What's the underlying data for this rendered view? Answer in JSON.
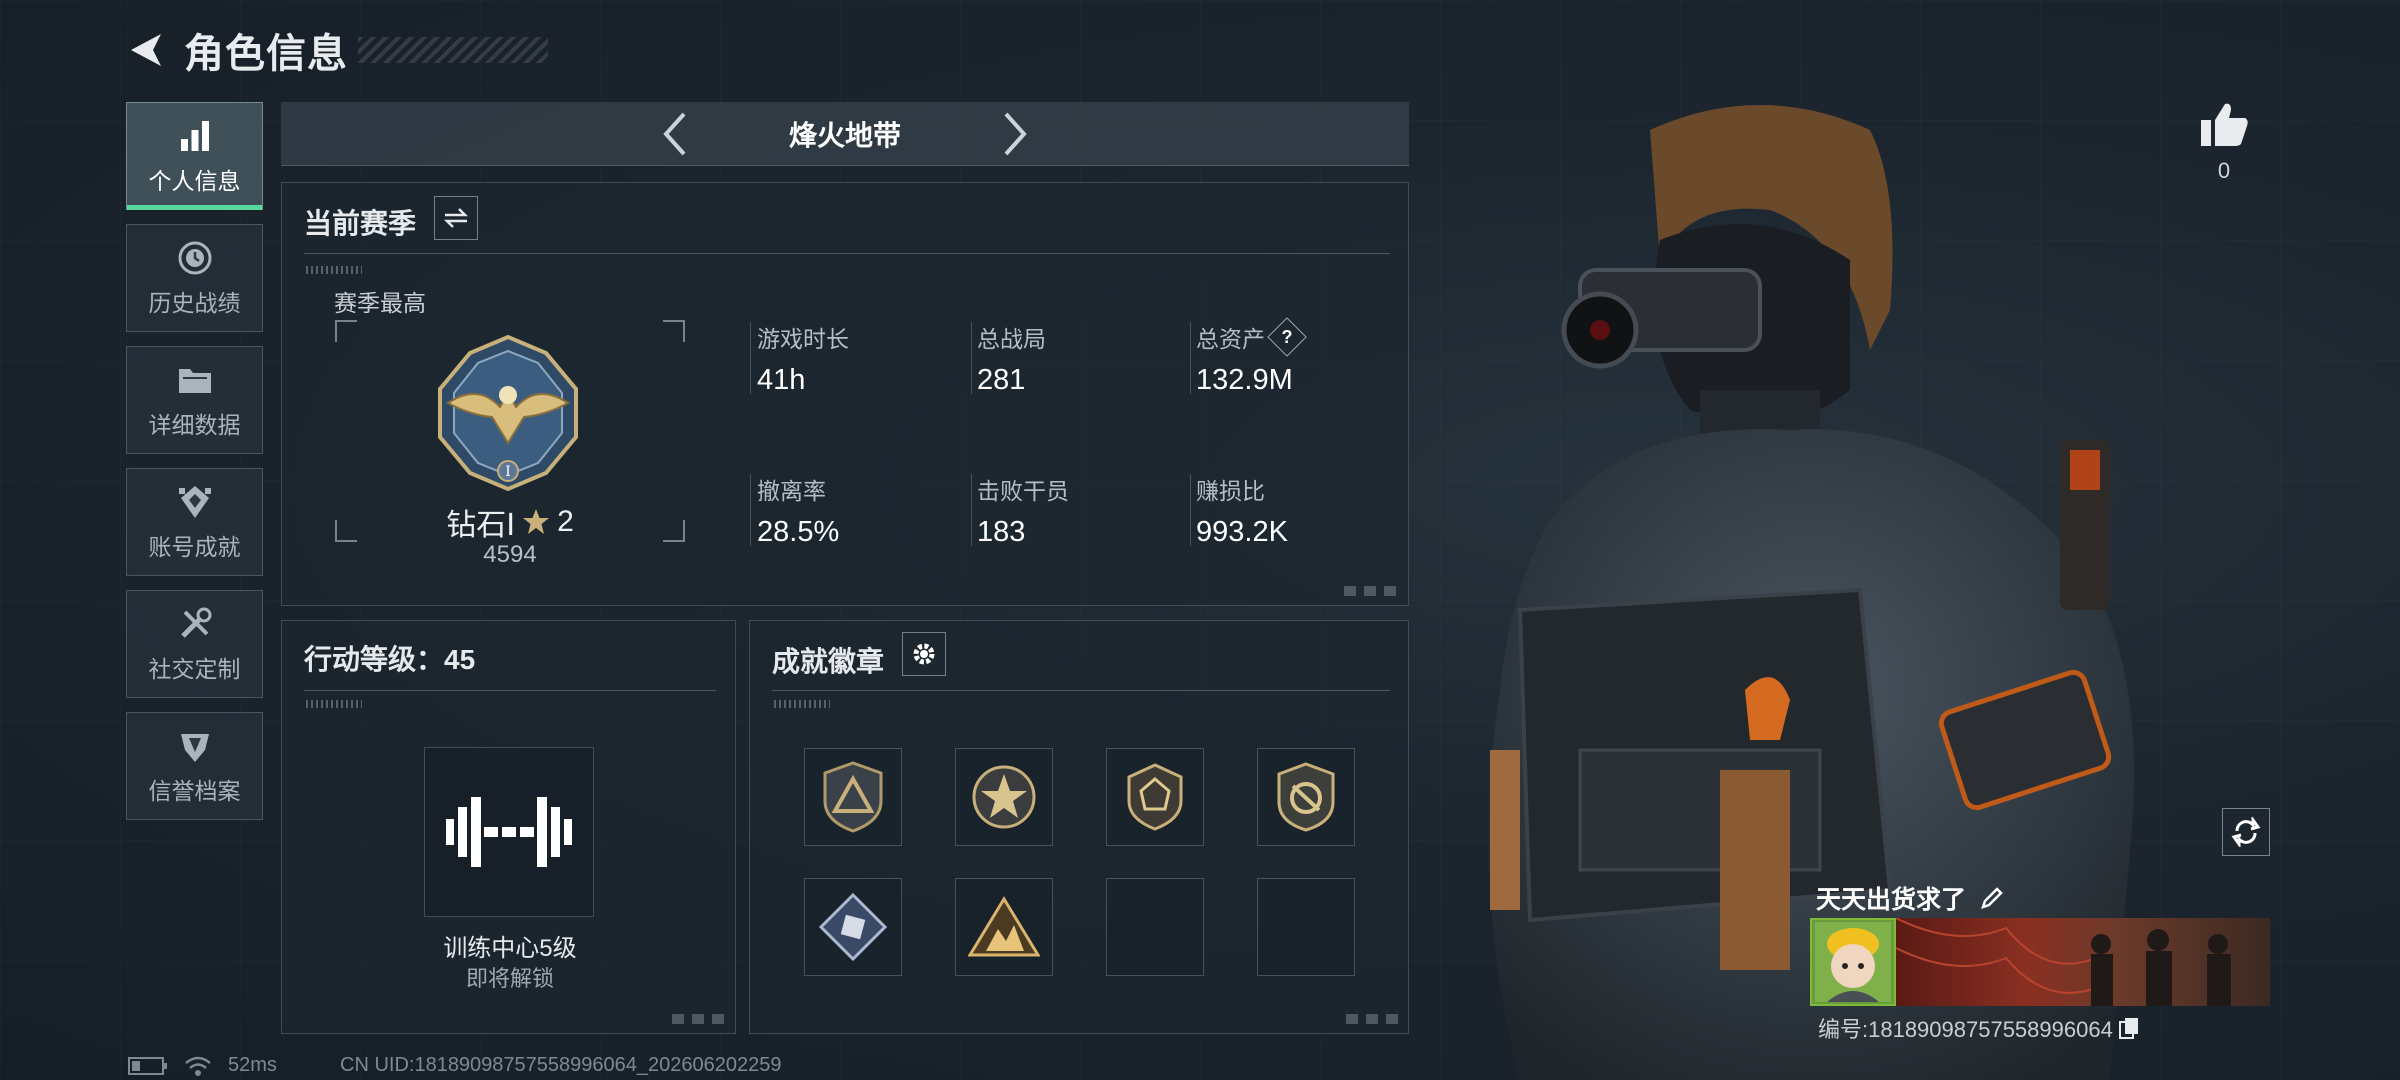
{
  "header": {
    "title": "角色信息"
  },
  "sidebar": {
    "items": [
      {
        "label": "个人信息",
        "icon": "bar-chart-icon",
        "active": true
      },
      {
        "label": "历史战绩",
        "icon": "history-icon",
        "active": false
      },
      {
        "label": "详细数据",
        "icon": "folder-icon",
        "active": false
      },
      {
        "label": "账号成就",
        "icon": "achievement-icon",
        "active": false
      },
      {
        "label": "社交定制",
        "icon": "tools-icon",
        "active": false
      },
      {
        "label": "信誉档案",
        "icon": "shield-icon",
        "active": false
      }
    ]
  },
  "mode": {
    "title": "烽火地带"
  },
  "season": {
    "title": "当前赛季",
    "best_label": "赛季最高",
    "rank_name": "钻石Ⅰ",
    "rank_stars": "2",
    "rank_score": "4594",
    "stats": [
      {
        "label": "游戏时长",
        "value": "41h"
      },
      {
        "label": "总战局",
        "value": "281"
      },
      {
        "label": "总资产",
        "value": "132.9M",
        "help": "?"
      },
      {
        "label": "撤离率",
        "value": "28.5%"
      },
      {
        "label": "击败干员",
        "value": "183"
      },
      {
        "label": "赚损比",
        "value": "993.2K"
      }
    ]
  },
  "level": {
    "title": "行动等级：45",
    "unlock_name": "训练中心5级",
    "unlock_sub": "即将解锁"
  },
  "badges": {
    "title": "成就徽章",
    "items": [
      "triangle-badge-icon",
      "star-badge-icon",
      "crest-badge-icon",
      "target-badge-icon",
      "diamond-badge-icon",
      "mountain-badge-icon",
      "empty-slot",
      "empty-slot"
    ]
  },
  "profile": {
    "likes": "0",
    "player_name": "天天出货求了",
    "player_id": "编号:18189098757558996064"
  },
  "footer": {
    "ping": "52ms",
    "uid": "CN UID:18189098757558996064_202606202259"
  },
  "colors": {
    "accent": "#56d89e",
    "panel_bg": "#1c262f"
  }
}
